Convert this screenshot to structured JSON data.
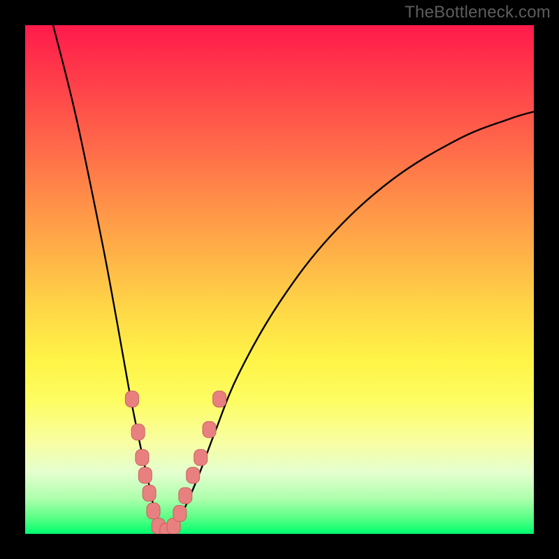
{
  "watermark": "TheBottleneck.com",
  "colors": {
    "background_black": "#000000",
    "gradient_top": "#ff1a4b",
    "gradient_bottom": "#00ff6f",
    "curve_stroke": "#000000",
    "marker_fill": "#e98080",
    "marker_stroke": "#c85f5f"
  },
  "chart_data": {
    "type": "line",
    "title": "",
    "xlabel": "",
    "ylabel": "",
    "xlim": [
      0,
      1
    ],
    "ylim": [
      0,
      1
    ],
    "grid": false,
    "legend": false,
    "notes": "Image has no axes, ticks, or labels. x and y are page-relative (0..1). y is plotted downward (0 at top, 1 at bottom). Curve is a V/funnel shape with minimum near x≈0.27 reaching y≈1; rises steeply toward top on both sides.",
    "series": [
      {
        "name": "curve",
        "x": [
          0.055,
          0.1,
          0.15,
          0.18,
          0.205,
          0.225,
          0.245,
          0.26,
          0.28,
          0.3,
          0.32,
          0.345,
          0.375,
          0.42,
          0.5,
          0.6,
          0.72,
          0.85,
          0.95,
          1.0
        ],
        "y": [
          0.0,
          0.18,
          0.42,
          0.58,
          0.72,
          0.82,
          0.91,
          0.975,
          0.995,
          0.975,
          0.935,
          0.875,
          0.795,
          0.685,
          0.545,
          0.415,
          0.305,
          0.225,
          0.185,
          0.17
        ]
      }
    ],
    "markers": {
      "name": "rounded-markers",
      "shape": "rounded-rect",
      "points_xy": [
        [
          0.21,
          0.735
        ],
        [
          0.222,
          0.8
        ],
        [
          0.23,
          0.85
        ],
        [
          0.236,
          0.885
        ],
        [
          0.244,
          0.92
        ],
        [
          0.252,
          0.955
        ],
        [
          0.262,
          0.985
        ],
        [
          0.278,
          0.995
        ],
        [
          0.292,
          0.985
        ],
        [
          0.304,
          0.96
        ],
        [
          0.315,
          0.925
        ],
        [
          0.33,
          0.885
        ],
        [
          0.345,
          0.85
        ],
        [
          0.362,
          0.795
        ],
        [
          0.382,
          0.735
        ]
      ]
    }
  }
}
